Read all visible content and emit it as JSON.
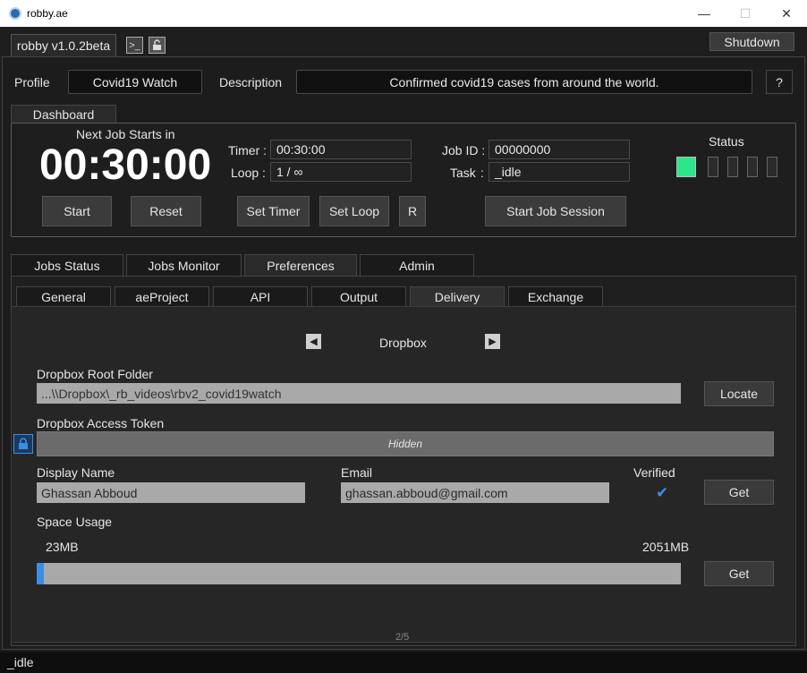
{
  "window": {
    "title": "robby.ae",
    "min": "—",
    "max": "☐",
    "close": "✕"
  },
  "header": {
    "version": "robby v1.0.2beta",
    "shutdown": "Shutdown"
  },
  "profile": {
    "profile_label": "Profile",
    "profile_value": "Covid19 Watch",
    "description_label": "Description",
    "description_value": "Confirmed covid19 cases from around the world.",
    "help": "?"
  },
  "dashboard": {
    "tab": "Dashboard",
    "next_job_label": "Next Job Starts in",
    "countdown": "00:30:00",
    "timer_label": "Timer :",
    "timer_value": "00:30:00",
    "loop_label": "Loop :",
    "loop_value": "1 / ∞",
    "job_id_label": "Job ID :",
    "job_id_value": "00000000",
    "task_label": "Task",
    "task_colon": ":",
    "task_value": "_idle",
    "status_label": "Status",
    "start": "Start",
    "reset": "Reset",
    "set_timer": "Set Timer",
    "set_loop": "Set Loop",
    "r": "R",
    "start_session": "Start Job Session",
    "status_color_on": "#2ee68a"
  },
  "main_tabs": [
    "Jobs Status",
    "Jobs Monitor",
    "Preferences",
    "Admin"
  ],
  "sub_tabs": [
    "General",
    "aeProject",
    "API",
    "Output",
    "Delivery",
    "Exchange"
  ],
  "delivery": {
    "service": "Dropbox",
    "root_folder_label": "Dropbox Root Folder",
    "root_folder_value": "...\\\\Dropbox\\_rb_videos\\rbv2_covid19watch",
    "locate": "Locate",
    "token_label": "Dropbox Access Token",
    "token_value": "Hidden",
    "display_name_label": "Display Name",
    "display_name_value": "Ghassan Abboud",
    "email_label": "Email",
    "email_value": "ghassan.abboud@gmail.com",
    "verified_label": "Verified",
    "verified_mark": "✔",
    "get": "Get",
    "space_label": "Space Usage",
    "space_used": "23MB",
    "space_total": "2051MB",
    "space_fraction": 0.011,
    "get2": "Get",
    "page": "2/5"
  },
  "statusbar": {
    "text": "_idle"
  },
  "colors": {
    "accent": "#3a8ee6",
    "led_on": "#2ee68a"
  }
}
